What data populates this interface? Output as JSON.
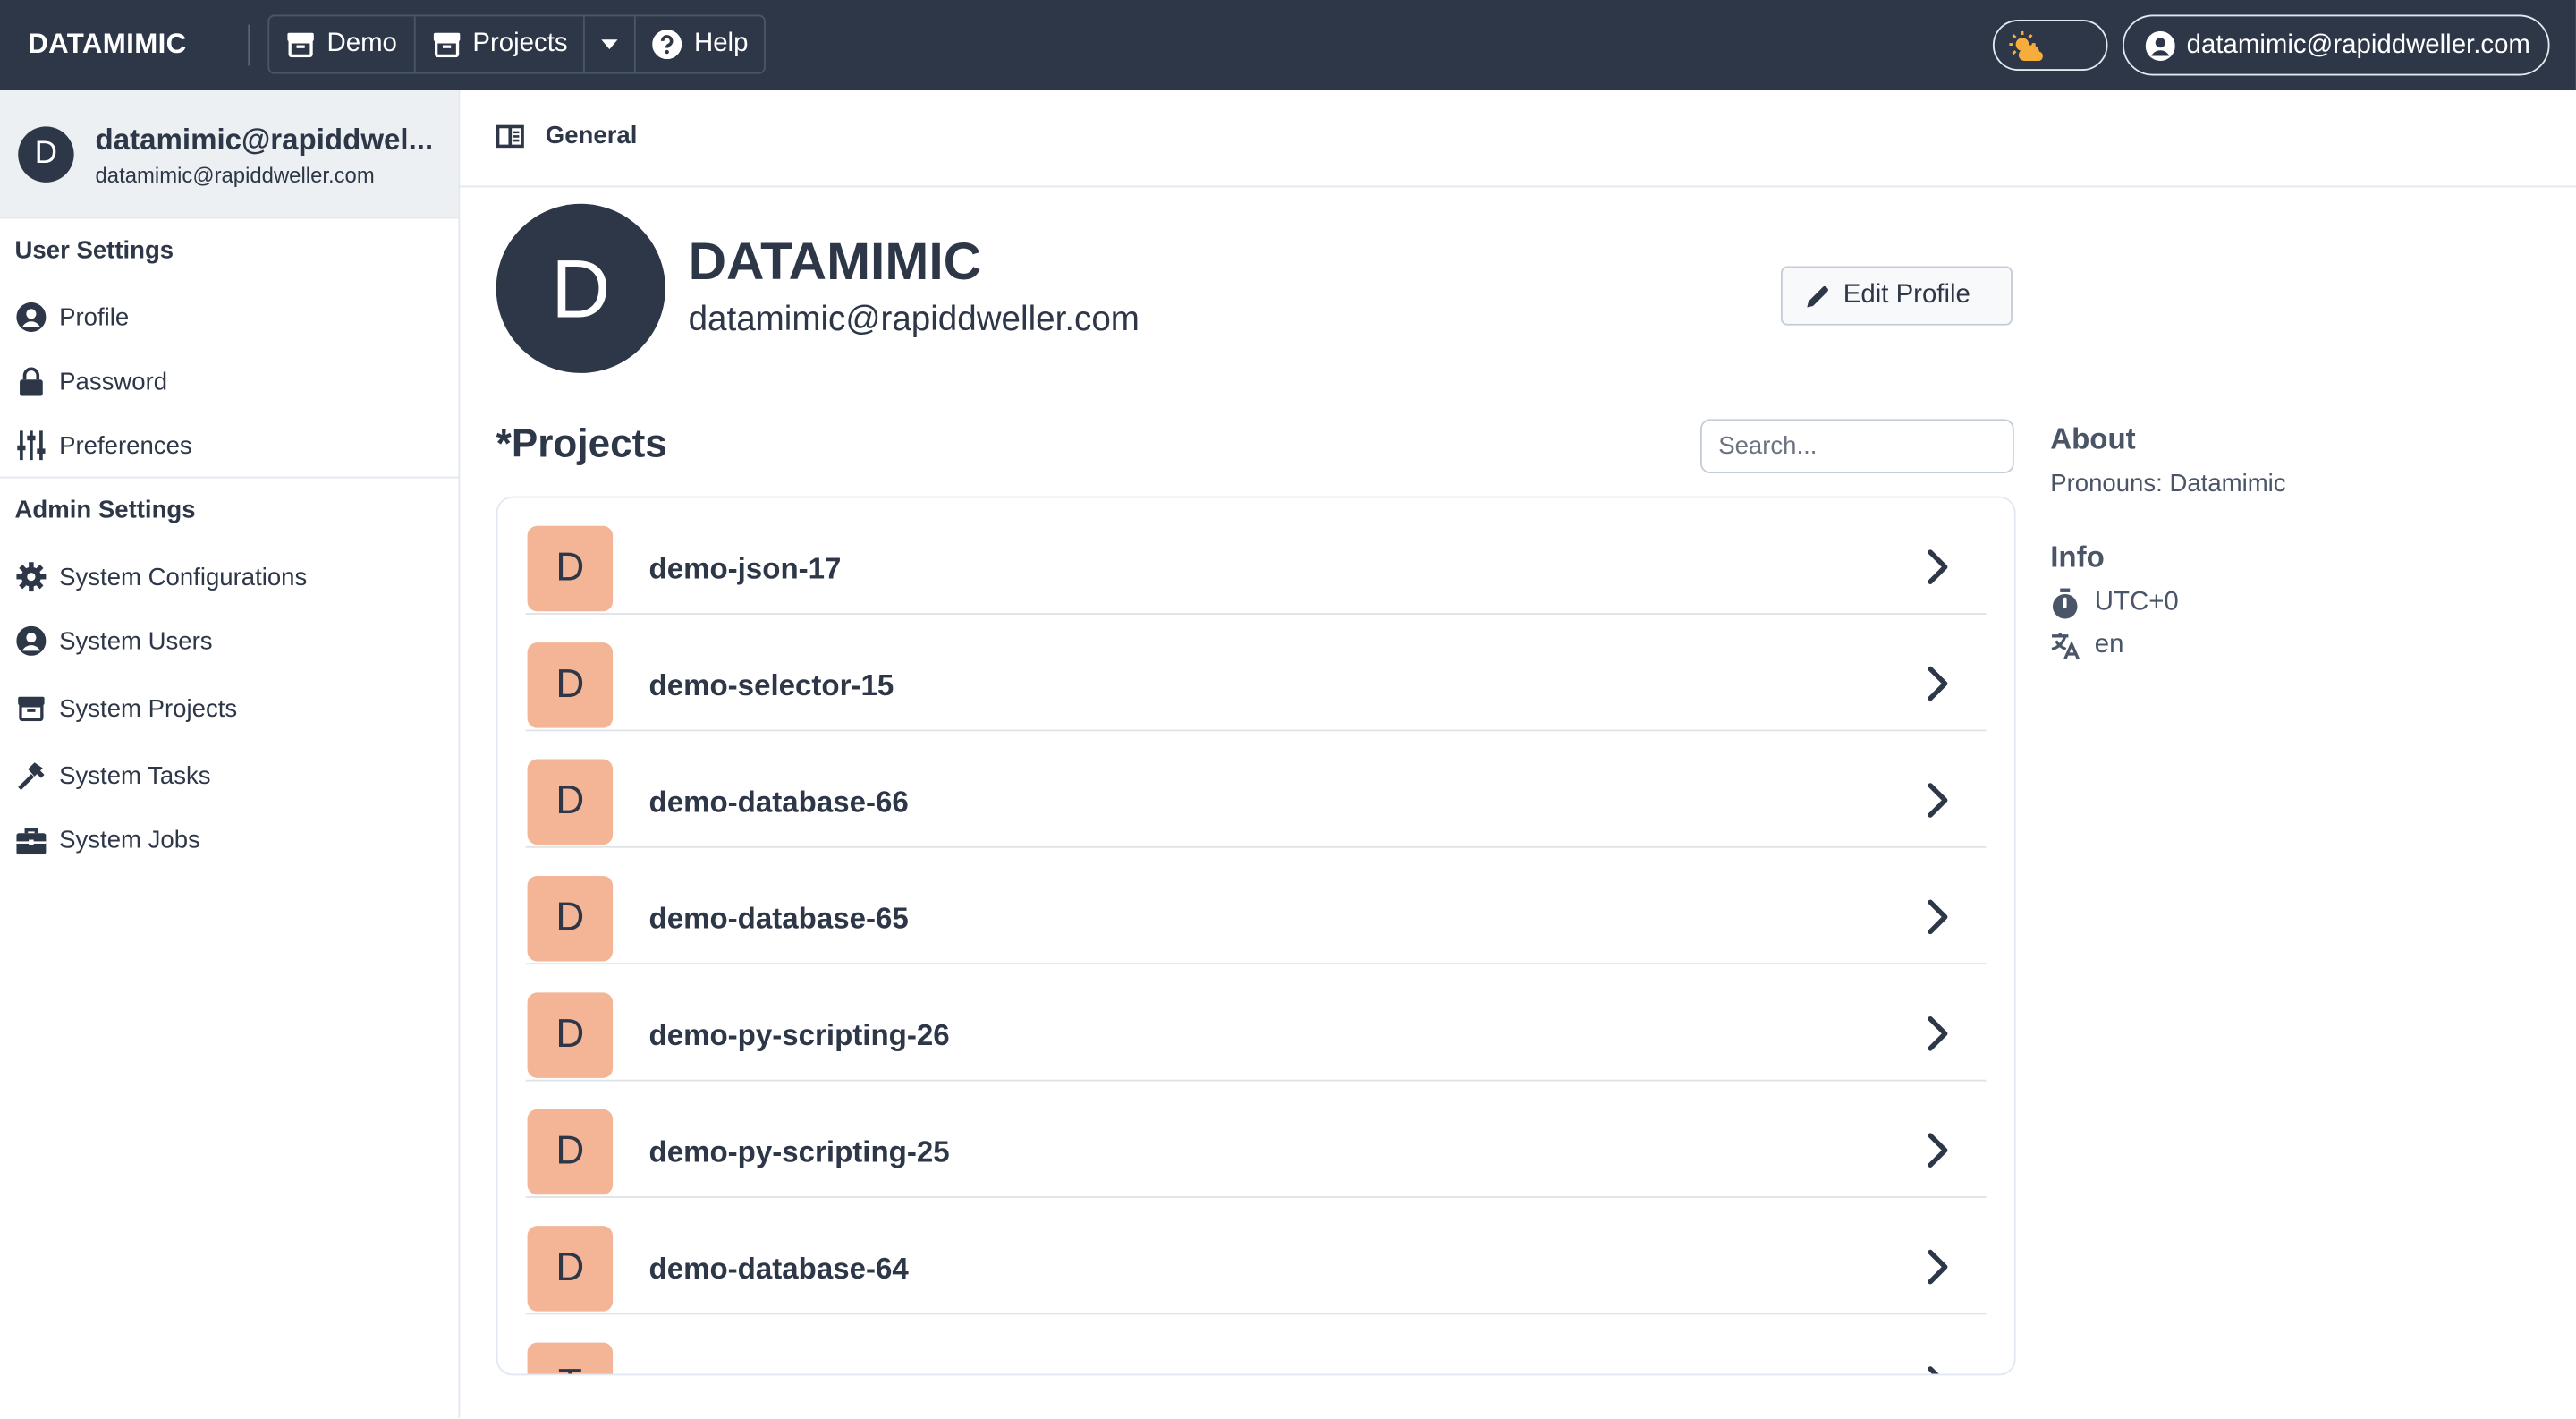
{
  "topbar": {
    "logo": "DATAMIMIC",
    "nav": {
      "demo": "Demo",
      "projects": "Projects",
      "help": "Help"
    },
    "user": "datamimic@rapiddweller.com"
  },
  "sidebar": {
    "user_name": "datamimic@rapiddwel...",
    "user_email": "datamimic@rapiddweller.com",
    "avatar_letter": "D",
    "user_settings_title": "User Settings",
    "user_settings": [
      "Profile",
      "Password",
      "Preferences"
    ],
    "admin_settings_title": "Admin Settings",
    "admin_settings": [
      "System Configurations",
      "System Users",
      "System Projects",
      "System Tasks",
      "System Jobs"
    ]
  },
  "header": {
    "title": "General"
  },
  "profile": {
    "avatar_letter": "D",
    "name": "DATAMIMIC",
    "email": "datamimic@rapiddweller.com",
    "edit_label": "Edit Profile"
  },
  "projects": {
    "title": "*Projects",
    "search_placeholder": "Search...",
    "items": [
      {
        "letter": "D",
        "name": "demo-json-17"
      },
      {
        "letter": "D",
        "name": "demo-selector-15"
      },
      {
        "letter": "D",
        "name": "demo-database-66"
      },
      {
        "letter": "D",
        "name": "demo-database-65"
      },
      {
        "letter": "D",
        "name": "demo-py-scripting-26"
      },
      {
        "letter": "D",
        "name": "demo-py-scripting-25"
      },
      {
        "letter": "D",
        "name": "demo-database-64"
      },
      {
        "letter": "T",
        "name": ""
      }
    ]
  },
  "about": {
    "title": "About",
    "pronouns": "Pronouns: Datamimic",
    "info_title": "Info",
    "timezone": "UTC+0",
    "language": "en"
  },
  "colors": {
    "topbar": "#2d3748",
    "project_avatar": "#f3b596",
    "text": "#2d3748"
  }
}
